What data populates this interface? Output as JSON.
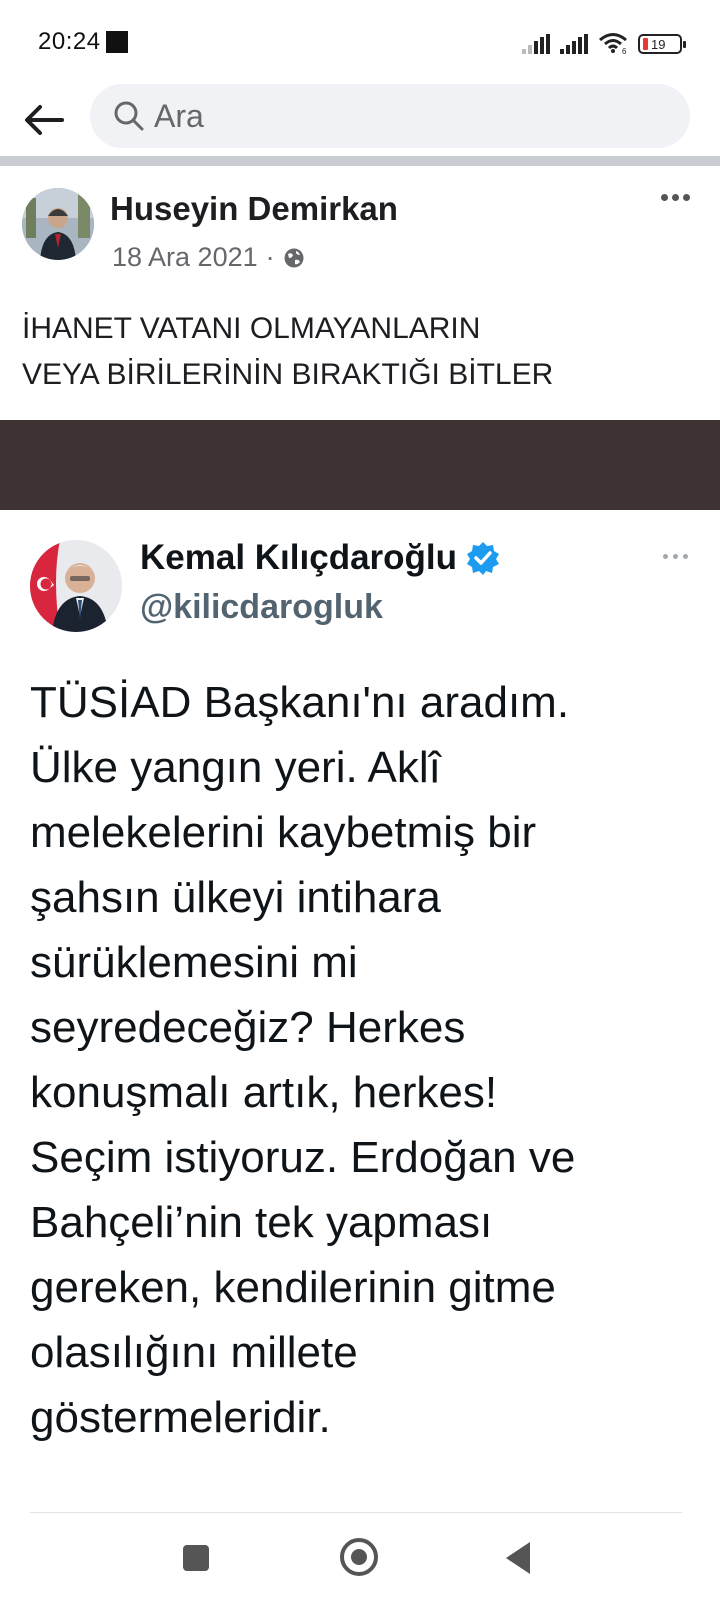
{
  "status_bar": {
    "time": "20:24",
    "battery": "19"
  },
  "search": {
    "placeholder": "Ara"
  },
  "post": {
    "author": "Huseyin Demirkan",
    "date": "18 Ara 2021",
    "separator": "·",
    "text_line1": "İHANET VATANI OLMAYANLARIN",
    "text_line2": "VEYA BİRİLERİNİN BIRAKTIĞI BİTLER"
  },
  "tweet": {
    "name": "Kemal Kılıçdaroğlu",
    "handle": "@kilicdarogluk",
    "lines": [
      "TÜSİAD Başkanı'nı aradım.",
      "Ülke yangın yeri. Aklî",
      "melekelerini kaybetmiş bir",
      "şahsın ülkeyi intihara",
      "sürüklemesini mi",
      "seyredeceğiz? Herkes",
      "konuşmalı artık, herkes!",
      "Seçim istiyoruz. Erdoğan ve",
      "Bahçeli’nin tek yapması",
      "gereken, kendilerinin gitme",
      "olasılığını millete",
      "göstermeleridir."
    ]
  },
  "colors": {
    "verified": "#1d9bf0",
    "band": "#3e3332",
    "search_bg": "#f0f2f5"
  },
  "icons": {
    "back": "arrow-left-icon",
    "search": "search-icon",
    "privacy": "globe-icon",
    "verified": "verified-badge-icon"
  }
}
